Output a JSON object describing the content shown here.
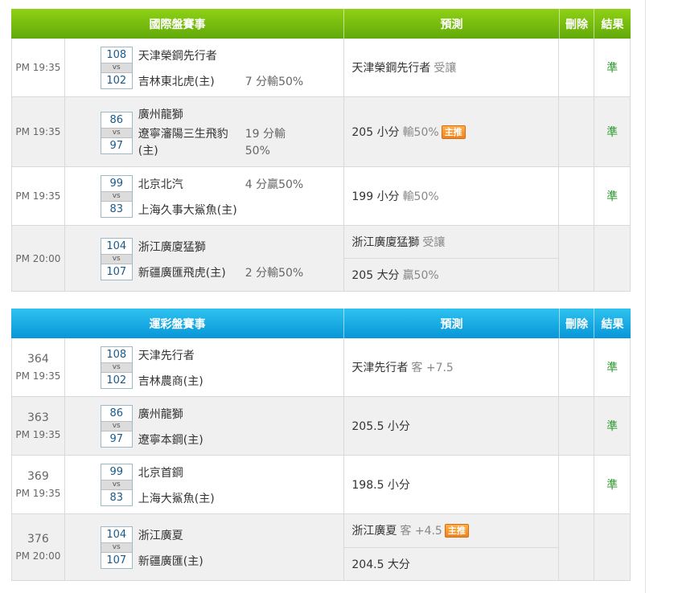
{
  "international": {
    "header": {
      "title": "國際盤賽事",
      "prediction": "預測",
      "delete": "刪除",
      "result": "結果"
    },
    "rows": [
      {
        "time": "PM 19:35",
        "away_score": "108",
        "home_score": "102",
        "vs": "vs",
        "away": "天津榮鋼先行者",
        "home": "吉林東北虎(主)",
        "handicap": "7 分輸50%",
        "pred1": "天津榮鋼先行者",
        "pred1_sub": "受讓",
        "result": "準"
      },
      {
        "time": "PM 19:35",
        "away_score": "86",
        "home_score": "97",
        "vs": "vs",
        "away": "廣州龍獅",
        "home": "遼寧瀋陽三生飛豹(主)",
        "handicap": "19 分輸50%",
        "pred1": "205 小分",
        "pred1_sub": "輸50%",
        "badge": "主推",
        "result": "準"
      },
      {
        "time": "PM 19:35",
        "away_score": "99",
        "home_score": "83",
        "vs": "vs",
        "away": "北京北汽",
        "home": "上海久事大鯊魚(主)",
        "handicap": "4 分贏50%",
        "pred1": "199 小分",
        "pred1_sub": "輸50%",
        "result": "準"
      },
      {
        "time": "PM 20:00",
        "away_score": "104",
        "home_score": "107",
        "vs": "vs",
        "away": "浙江廣廈猛獅",
        "home": "新疆廣匯飛虎(主)",
        "handicap": "2 分輸50%",
        "pred1": "浙江廣廈猛獅",
        "pred1_sub": "受讓",
        "pred2": "205 大分",
        "pred2_sub": "贏50%"
      }
    ]
  },
  "lottery": {
    "header": {
      "title": "運彩盤賽事",
      "prediction": "預測",
      "delete": "刪除",
      "result": "結果"
    },
    "rows": [
      {
        "num": "364",
        "time": "PM 19:35",
        "away_score": "108",
        "home_score": "102",
        "vs": "vs",
        "away": "天津先行者",
        "home": "吉林農商(主)",
        "pred1": "天津先行者",
        "pred1_sub": "客 +7.5",
        "result": "準"
      },
      {
        "num": "363",
        "time": "PM 19:35",
        "away_score": "86",
        "home_score": "97",
        "vs": "vs",
        "away": "廣州龍獅",
        "home": "遼寧本鋼(主)",
        "pred1": "205.5 小分",
        "result": "準"
      },
      {
        "num": "369",
        "time": "PM 19:35",
        "away_score": "99",
        "home_score": "83",
        "vs": "vs",
        "away": "北京首鋼",
        "home": "上海大鯊魚(主)",
        "pred1": "198.5 小分",
        "result": "準"
      },
      {
        "num": "376",
        "time": "PM 20:00",
        "away_score": "104",
        "home_score": "107",
        "vs": "vs",
        "away": "浙江廣夏",
        "home": "新疆廣匯(主)",
        "pred1": "浙江廣夏",
        "pred1_sub": "客 +4.5",
        "badge": "主推",
        "pred2": "204.5 大分"
      }
    ]
  }
}
